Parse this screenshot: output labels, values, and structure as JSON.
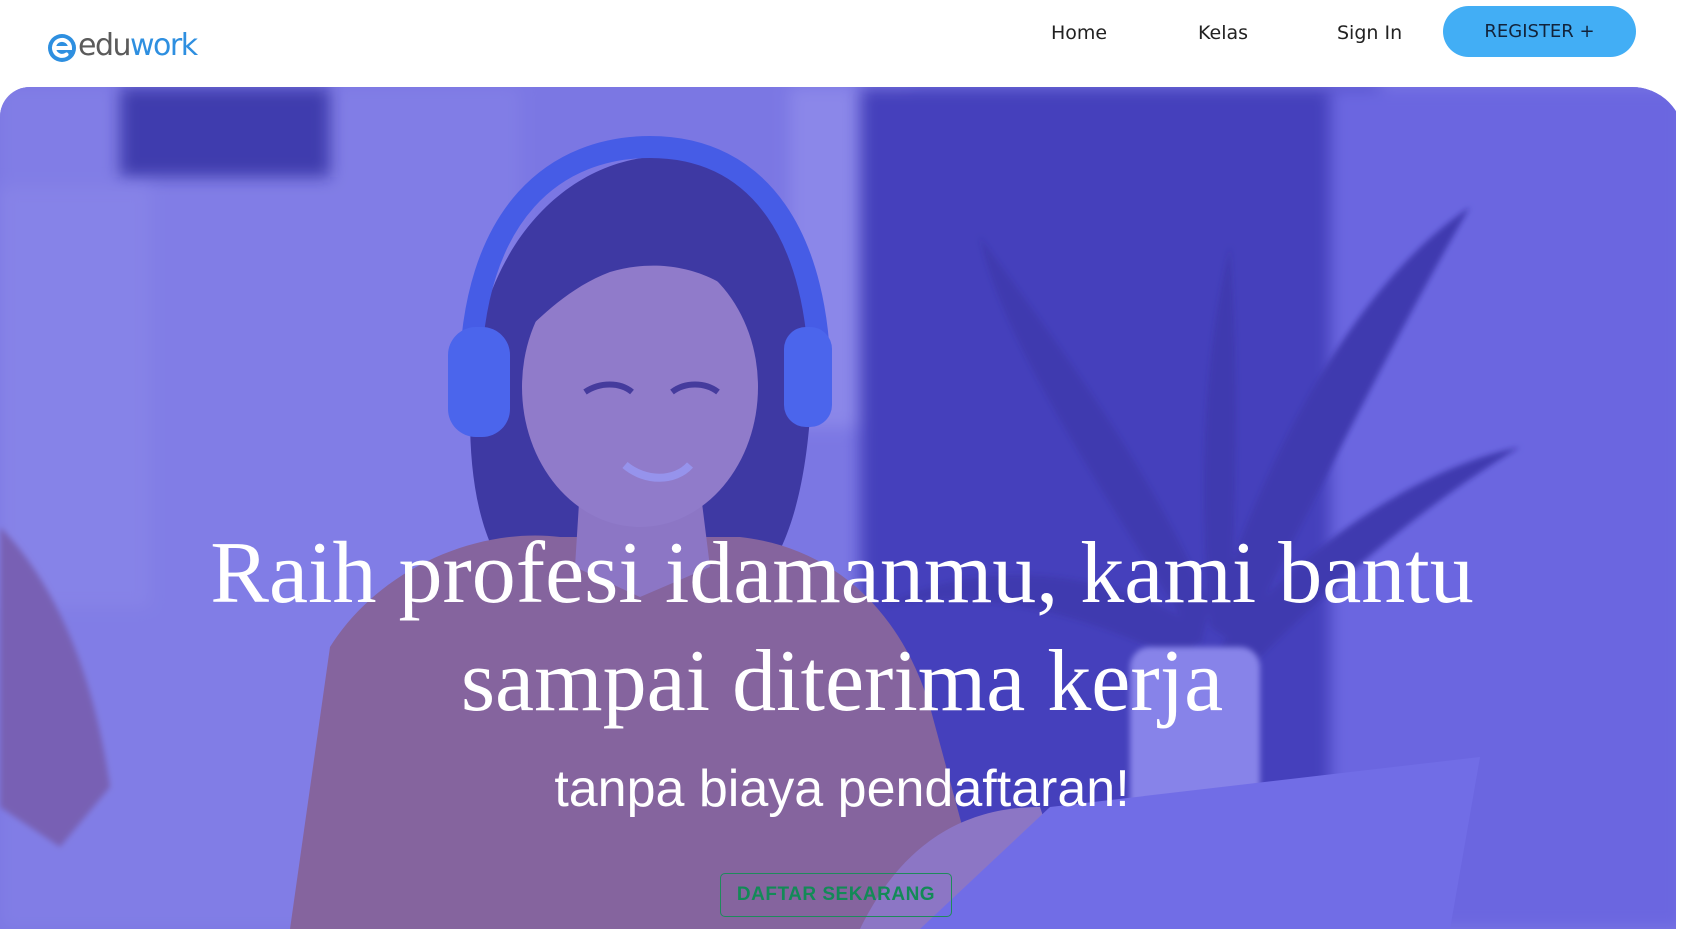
{
  "header": {
    "logo": {
      "icon": "eduwork-e-logo-icon",
      "text_part1": "edu",
      "text_part2": "work"
    },
    "nav": {
      "home_label": "Home",
      "kelas_label": "Kelas",
      "signin_label": "Sign In"
    },
    "register_label": "REGISTER +"
  },
  "hero": {
    "image": "woman-with-headphones-smiling-at-laptop-photo",
    "title_line1": "Raih profesi idamanmu, kami bantu",
    "title_line2": "sampai diterima kerja",
    "subtitle": "tanpa biaya pendaftaran!",
    "cta_label": "DAFTAR SEKARANG"
  },
  "colors": {
    "accent": "#42aef5",
    "brand_blue": "#2e8fe0",
    "hero_overlay": "#5650e1",
    "cta_text": "#138a57"
  }
}
